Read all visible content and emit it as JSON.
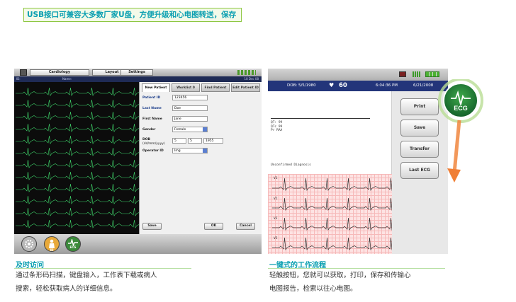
{
  "banner": {
    "text": "USB接口可兼容大多数厂家U盘，方便升级和心电图转送，保存"
  },
  "left_device": {
    "menu_tabs": [
      "Cardiology",
      "Layout",
      "Settings"
    ],
    "status": {
      "left": "ID:",
      "name": "Name:",
      "right": "18 Dec 08"
    },
    "panel": {
      "tabs": [
        "New Patient",
        "Worklist 0",
        "Find Patient",
        "Edit Patient ID"
      ],
      "fields": {
        "patient_id": {
          "label": "Patient ID",
          "value": "123456"
        },
        "last_name": {
          "label": "Last Name",
          "value": "Doe"
        },
        "first_name": {
          "label": "First Name",
          "value": "Jane"
        },
        "gender": {
          "label": "Gender",
          "value": "Female"
        },
        "dob": {
          "label": "DOB",
          "sublabel": "(dd/mm/yyyy)",
          "day": "5",
          "month": "5",
          "year": "1955"
        },
        "operator_id": {
          "label": "Operator ID",
          "value": "Img"
        }
      },
      "buttons": {
        "save": "Save",
        "ok": "OK",
        "cancel": "Cancel"
      }
    },
    "dock": {
      "ecg": "ECG",
      "id": "ID"
    }
  },
  "caption_left": {
    "title": "及时访问",
    "lines": [
      "通过条形码扫描，键盘输入，工作表下载或病人",
      "搜索，轻松获取病人的详细信息。"
    ]
  },
  "right_device": {
    "status": {
      "dob": "DOB: 5/5/1980",
      "hr": "60",
      "time": "6:04:36 PM",
      "date": "6/21/2008"
    },
    "report": {
      "lines": [
        "QT: 99",
        "QTc 99",
        "Pr RAA"
      ],
      "diagnosis": "Unconfirmed Diagnosis",
      "leads": [
        "V1",
        "V2",
        "V3",
        "V5"
      ]
    },
    "buttons": [
      "Print",
      "Save",
      "Transfer",
      "Last ECG"
    ]
  },
  "caption_right": {
    "title": "一键式的工作流程",
    "lines": [
      "轻触按钮，您就可以获取，打印，保存和传输心",
      "电图报告，检索以往心电图。"
    ]
  },
  "badge": {
    "label": "ECG"
  }
}
